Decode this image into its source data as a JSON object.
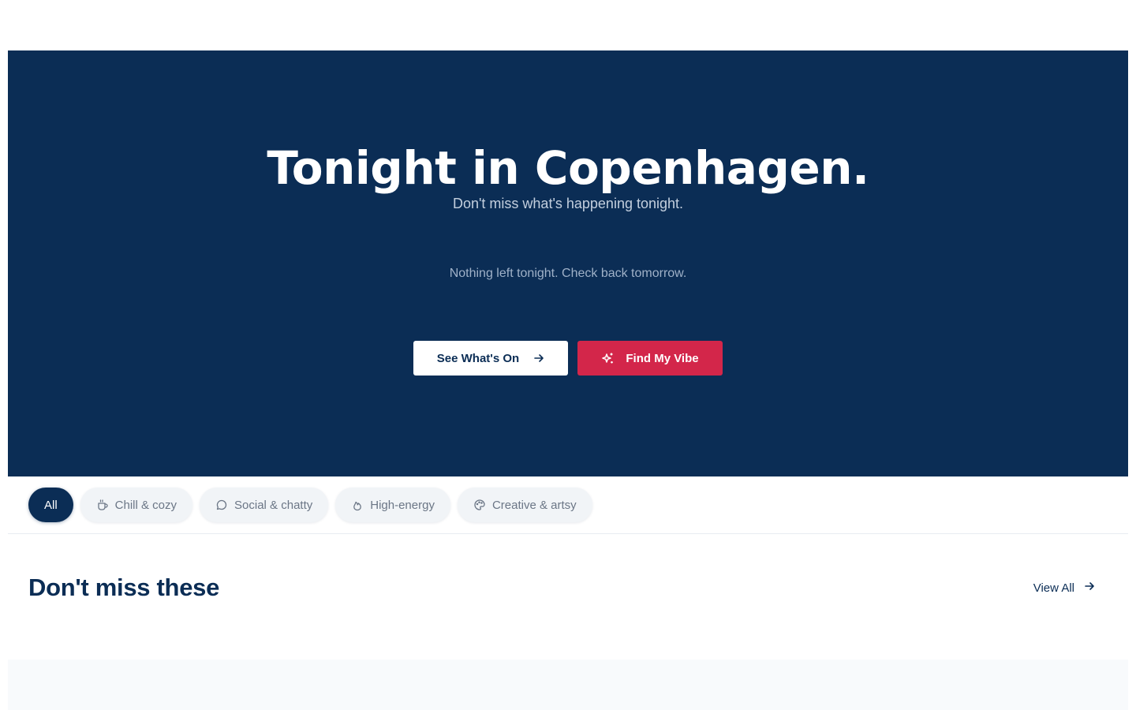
{
  "hero": {
    "title": "Tonight in Copenhagen.",
    "subtitle": "Don't miss what's happening tonight.",
    "empty_message": "Nothing left tonight. Check back tomorrow.",
    "primary_button": "See What's On",
    "accent_button": "Find My Vibe",
    "background_color": "#0b2d55",
    "accent_color": "#d3264a"
  },
  "filters": {
    "selected": "All",
    "chips": [
      {
        "label": "All",
        "icon": null
      },
      {
        "label": "Chill & cozy",
        "icon": "coffee-cup-icon"
      },
      {
        "label": "Social & chatty",
        "icon": "chat-bubble-icon"
      },
      {
        "label": "High-energy",
        "icon": "flame-icon"
      },
      {
        "label": "Creative & artsy",
        "icon": "palette-icon"
      }
    ]
  },
  "section": {
    "title": "Don't miss these",
    "view_all": "View All"
  }
}
